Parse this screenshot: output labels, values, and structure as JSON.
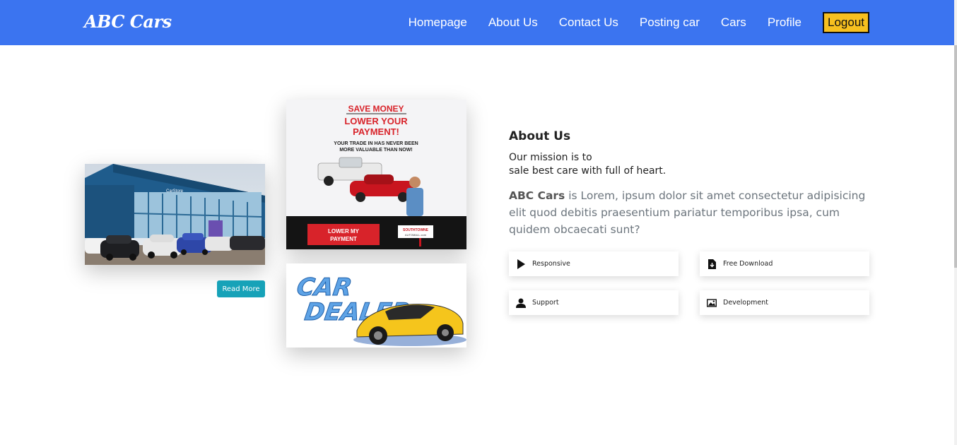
{
  "navbar": {
    "brand": "ABC Cars",
    "links": [
      "Homepage",
      "About Us",
      "Contact Us",
      "Posting car",
      "Cars",
      "Profile"
    ],
    "logout": "Logout",
    "colors": {
      "background": "#3b74f0",
      "logout": "#f7c01f"
    }
  },
  "images": {
    "store": {
      "sign": "CarStore"
    },
    "ad": {
      "headline1": "SAVE MONEY",
      "headline2": "LOWER YOUR",
      "headline3": "PAYMENT!",
      "tagline1": "YOUR TRADE IN HAS NEVER BEEN",
      "tagline2": "MORE VALUABLE THAN NOW!",
      "button1": "LOWER MY",
      "button2": "PAYMENT",
      "dealer1": "SOUTHTOWNE",
      "dealer2": "AUTOMALL.com"
    },
    "dealer": {
      "line1": "CAR",
      "line2": "DEALER"
    }
  },
  "read_more": "Read More",
  "about": {
    "title": "About Us",
    "mission_line1": "Our mission is to",
    "mission_line2": "sale best care with full of heart.",
    "brand_bold": "ABC Cars",
    "description": " is Lorem, ipsum dolor sit amet consectetur adipisicing elit quod debitis praesentium pariatur temporibus ipsa, cum quidem obcaecati sunt?"
  },
  "features": [
    {
      "label": "Responsive",
      "icon": "play-icon"
    },
    {
      "label": "Free Download",
      "icon": "file-download-icon"
    },
    {
      "label": "Support",
      "icon": "user-icon"
    },
    {
      "label": "Development",
      "icon": "image-icon"
    }
  ],
  "colors": {
    "read_more": "#17a2b8"
  }
}
